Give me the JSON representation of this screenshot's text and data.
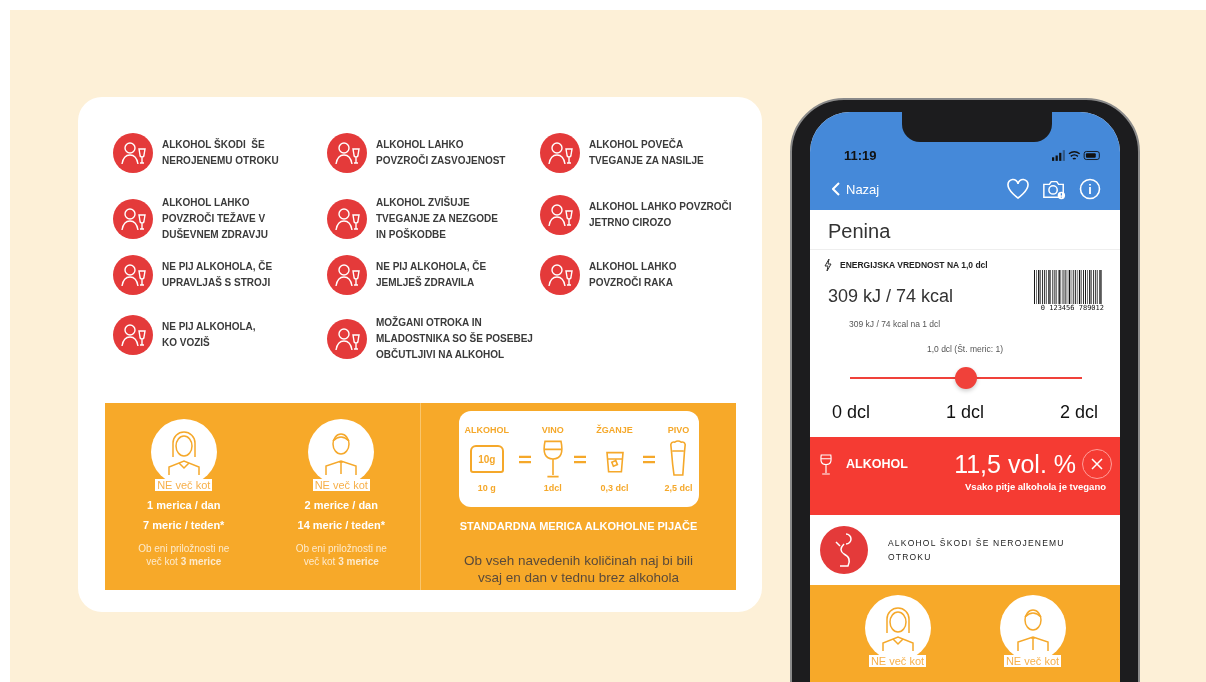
{
  "warnings": [
    {
      "text": "ALKOHOL ŠKODI  ŠE\nNEROJENEMU OTROKU"
    },
    {
      "text": "ALKOHOL LAHKO\nPOVZROČI ZASVOJENOST"
    },
    {
      "text": "ALKOHOL POVEČA\nTVEGANJE ZA NASILJE"
    },
    {
      "text": "ALKOHOL LAHKO\nPOVZROČI TEŽAVE V\nDUŠEVNEM ZDRAVJU"
    },
    {
      "text": "ALKOHOL ZVIŠUJE\nTVEGANJE ZA NEZGODE\nIN POŠKODBE"
    },
    {
      "text": "ALKOHOL LAHKO POVZROČI\nJETRNO CIROZO"
    },
    {
      "text": "NE PIJ ALKOHOLA, ČE\nUPRAVLJAŠ S STROJI"
    },
    {
      "text": "NE PIJ ALKOHOLA, ČE\nJEMLJEŠ ZDRAVILA"
    },
    {
      "text": "ALKOHOL LAHKO\nPOVZROČI RAKA"
    },
    {
      "text": "NE PIJ ALKOHOLA,\nKO VOZIŠ"
    },
    {
      "text": "MOŽGANI OTROKA IN\nMLADOSTNIKA SO ŠE POSEBEJ\nOBČUTLJIVI NA ALKOHOL"
    }
  ],
  "limits": [
    {
      "kind": "female",
      "badge": "NE več kot",
      "daily": "1 merica / dan",
      "weekly": "7 meric / teden*",
      "note": "Ob eni priložnosti ne\nveč kot **3 merice**"
    },
    {
      "kind": "male",
      "badge": "NE več kot",
      "daily": "2 merice / dan",
      "weekly": "14 meric / teden*",
      "note": "Ob eni priložnosti ne\nveč kot **3 merice**"
    }
  ],
  "standard_drink": {
    "items": [
      {
        "kind": "weight",
        "label": "ALKOHOL",
        "icon_text": "10g",
        "amount": "10 g"
      },
      {
        "kind": "wine",
        "label": "VINO",
        "amount": "1dcl"
      },
      {
        "kind": "spirit",
        "label": "ŽGANJE",
        "amount": "0,3 dcl"
      },
      {
        "kind": "beer",
        "label": "PIVO",
        "amount": "2,5 dcl"
      }
    ],
    "title": "STANDARDNA MERICA ALKOHOLNE PIJAČE",
    "note": "Ob vseh navedenih količinah naj bi bili\nvsaj en dan v tednu brez alkohola"
  },
  "phone": {
    "time": "11:19",
    "back": "Nazaj",
    "product": "Penina",
    "energy_label": "ENERGIJSKA VREDNOST NA 1,0 dcl",
    "energy": "309 kJ / 74 kcal",
    "energy_note": "309 kJ / 74 kcal na 1 dcl",
    "barcode_number": "0  123456  789012",
    "slider": {
      "caption": "1,0 dcl (Št. meric: 1)",
      "level": 0.5,
      "ticks": [
        "0 dcl",
        "1 dcl",
        "2 dcl"
      ]
    },
    "alcohol_label": "ALKOHOL",
    "alcohol_value": "11,5 vol. %",
    "alcohol_note": "Vsako pitje alkohola je tvegano",
    "warning": "ALKOHOL ŠKODI ŠE NEROJENEMU\nOTROKU",
    "limits": [
      {
        "kind": "female",
        "badge": "NE več kot"
      },
      {
        "kind": "male",
        "badge": "NE več kot"
      }
    ]
  }
}
